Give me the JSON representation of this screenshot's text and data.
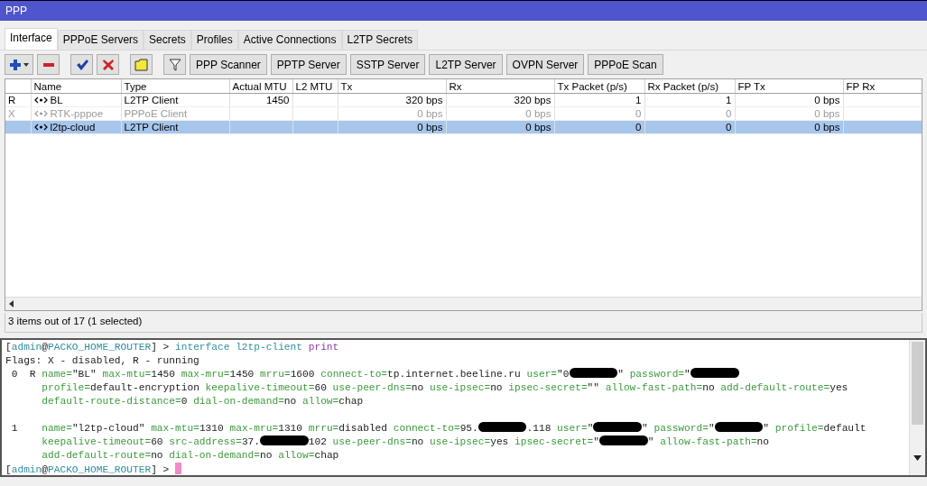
{
  "window": {
    "title": "PPP"
  },
  "tabs": [
    {
      "label": "Interface",
      "selected": true
    },
    {
      "label": "PPPoE Servers",
      "selected": false
    },
    {
      "label": "Secrets",
      "selected": false
    },
    {
      "label": "Profiles",
      "selected": false
    },
    {
      "label": "Active Connections",
      "selected": false
    },
    {
      "label": "L2TP Secrets",
      "selected": false
    }
  ],
  "toolbar": {
    "icon_buttons": [
      {
        "kind": "add"
      },
      {
        "kind": "remove"
      },
      {
        "kind": "enable"
      },
      {
        "kind": "disable"
      },
      {
        "kind": "comment"
      },
      {
        "kind": "filter"
      }
    ],
    "buttons": [
      "PPP Scanner",
      "PPTP Server",
      "SSTP Server",
      "L2TP Server",
      "OVPN Server",
      "PPPoE Scan"
    ]
  },
  "table": {
    "columns": [
      "Name",
      "Type",
      "Actual MTU",
      "L2 MTU",
      "Tx",
      "Rx",
      "Tx Packet (p/s)",
      "Rx Packet (p/s)",
      "FP Tx",
      "FP Rx"
    ],
    "rows": [
      {
        "flag": "R",
        "disabled": false,
        "selected": false,
        "cells": [
          "BL",
          "L2TP Client",
          "1450",
          null,
          "320 bps",
          "320 bps",
          "1",
          "1",
          "0 bps"
        ]
      },
      {
        "flag": "X",
        "disabled": true,
        "selected": false,
        "cells": [
          "RTK-pppoe",
          "PPPoE Client",
          null,
          null,
          "0 bps",
          "0 bps",
          "0",
          "0",
          "0 bps"
        ]
      },
      {
        "flag": null,
        "disabled": false,
        "selected": true,
        "cells": [
          "l2tp-cloud",
          "L2TP Client",
          null,
          null,
          "0 bps",
          "0 bps",
          "0",
          "0",
          "0 bps"
        ]
      }
    ]
  },
  "status_bar": "3 items out of 17 (1 selected)",
  "terminal": {
    "lines": [
      {
        "indent": false,
        "blank_before": false,
        "segments": [
          {
            "kind": "text",
            "text": "["
          },
          {
            "kind": "cmd",
            "text": "admin"
          },
          {
            "kind": "text",
            "text": "@"
          },
          {
            "kind": "cmd",
            "text": "PACKO_HOME_ROUTER"
          },
          {
            "kind": "text",
            "text": "] > "
          },
          {
            "kind": "cmd",
            "text": "interface l2tp-client "
          },
          {
            "kind": "verb",
            "text": "print"
          }
        ]
      },
      {
        "indent": false,
        "blank_before": false,
        "segments": [
          {
            "kind": "text",
            "text": "Flags: X - disabled, R - running"
          }
        ]
      },
      {
        "indent": false,
        "blank_before": false,
        "segments": [
          {
            "kind": "text",
            "text": " 0  R "
          },
          {
            "kind": "key",
            "text": "name="
          },
          {
            "kind": "text",
            "text": "\"BL\" "
          },
          {
            "kind": "key",
            "text": "max-mtu="
          },
          {
            "kind": "text",
            "text": "1450 "
          },
          {
            "kind": "key",
            "text": "max-mru="
          },
          {
            "kind": "text",
            "text": "1450 "
          },
          {
            "kind": "key",
            "text": "mrru="
          },
          {
            "kind": "text",
            "text": "1600 "
          },
          {
            "kind": "key",
            "text": "connect-to="
          },
          {
            "kind": "text",
            "text": "tp.internet.beeline.ru "
          },
          {
            "kind": "key",
            "text": "user="
          },
          {
            "kind": "text",
            "text": "\"0"
          },
          {
            "kind": "redacted"
          },
          {
            "kind": "text",
            "text": "\" "
          },
          {
            "kind": "key",
            "text": "password="
          },
          {
            "kind": "text",
            "text": "\""
          },
          {
            "kind": "redacted"
          }
        ]
      },
      {
        "indent": true,
        "blank_before": false,
        "segments": [
          {
            "kind": "key",
            "text": "profile="
          },
          {
            "kind": "text",
            "text": "default-encryption "
          },
          {
            "kind": "key",
            "text": "keepalive-timeout="
          },
          {
            "kind": "text",
            "text": "60 "
          },
          {
            "kind": "key",
            "text": "use-peer-dns="
          },
          {
            "kind": "text",
            "text": "no "
          },
          {
            "kind": "key",
            "text": "use-ipsec="
          },
          {
            "kind": "text",
            "text": "no "
          },
          {
            "kind": "key",
            "text": "ipsec-secret="
          },
          {
            "kind": "text",
            "text": "\"\" "
          },
          {
            "kind": "key",
            "text": "allow-fast-path="
          },
          {
            "kind": "text",
            "text": "no "
          },
          {
            "kind": "key",
            "text": "add-default-route="
          },
          {
            "kind": "text",
            "text": "yes"
          }
        ]
      },
      {
        "indent": true,
        "blank_before": false,
        "segments": [
          {
            "kind": "key",
            "text": "default-route-distance="
          },
          {
            "kind": "text",
            "text": "0 "
          },
          {
            "kind": "key",
            "text": "dial-on-demand="
          },
          {
            "kind": "text",
            "text": "no "
          },
          {
            "kind": "key",
            "text": "allow="
          },
          {
            "kind": "text",
            "text": "chap"
          }
        ]
      },
      {
        "indent": false,
        "blank_before": true,
        "segments": [
          {
            "kind": "text",
            "text": " 1    "
          },
          {
            "kind": "key",
            "text": "name="
          },
          {
            "kind": "text",
            "text": "\"l2tp-cloud\" "
          },
          {
            "kind": "key",
            "text": "max-mtu="
          },
          {
            "kind": "text",
            "text": "1310 "
          },
          {
            "kind": "key",
            "text": "max-mru="
          },
          {
            "kind": "text",
            "text": "1310 "
          },
          {
            "kind": "key",
            "text": "mrru="
          },
          {
            "kind": "text",
            "text": "disabled "
          },
          {
            "kind": "key",
            "text": "connect-to="
          },
          {
            "kind": "text",
            "text": "95."
          },
          {
            "kind": "redacted"
          },
          {
            "kind": "text",
            "text": ".118 "
          },
          {
            "kind": "key",
            "text": "user="
          },
          {
            "kind": "text",
            "text": "\""
          },
          {
            "kind": "redacted"
          },
          {
            "kind": "text",
            "text": "\" "
          },
          {
            "kind": "key",
            "text": "password="
          },
          {
            "kind": "text",
            "text": "\""
          },
          {
            "kind": "redacted"
          },
          {
            "kind": "text",
            "text": "\" "
          },
          {
            "kind": "key",
            "text": "profile="
          },
          {
            "kind": "text",
            "text": "default"
          }
        ]
      },
      {
        "indent": true,
        "blank_before": false,
        "segments": [
          {
            "kind": "key",
            "text": "keepalive-timeout="
          },
          {
            "kind": "text",
            "text": "60 "
          },
          {
            "kind": "key",
            "text": "src-address="
          },
          {
            "kind": "text",
            "text": "37."
          },
          {
            "kind": "redacted"
          },
          {
            "kind": "text",
            "text": "102 "
          },
          {
            "kind": "key",
            "text": "use-peer-dns="
          },
          {
            "kind": "text",
            "text": "no "
          },
          {
            "kind": "key",
            "text": "use-ipsec="
          },
          {
            "kind": "text",
            "text": "yes "
          },
          {
            "kind": "key",
            "text": "ipsec-secret="
          },
          {
            "kind": "text",
            "text": "\""
          },
          {
            "kind": "redacted"
          },
          {
            "kind": "text",
            "text": "\" "
          },
          {
            "kind": "key",
            "text": "allow-fast-path="
          },
          {
            "kind": "text",
            "text": "no"
          }
        ]
      },
      {
        "indent": true,
        "blank_before": false,
        "segments": [
          {
            "kind": "key",
            "text": "add-default-route="
          },
          {
            "kind": "text",
            "text": "no "
          },
          {
            "kind": "key",
            "text": "dial-on-demand="
          },
          {
            "kind": "text",
            "text": "no "
          },
          {
            "kind": "key",
            "text": "allow="
          },
          {
            "kind": "text",
            "text": "chap"
          }
        ]
      },
      {
        "indent": false,
        "blank_before": false,
        "segments": [
          {
            "kind": "text",
            "text": "["
          },
          {
            "kind": "cmd",
            "text": "admin"
          },
          {
            "kind": "text",
            "text": "@"
          },
          {
            "kind": "cmd",
            "text": "PACKO_HOME_ROUTER"
          },
          {
            "kind": "text",
            "text": "] > "
          },
          {
            "kind": "cursor"
          }
        ]
      }
    ]
  }
}
